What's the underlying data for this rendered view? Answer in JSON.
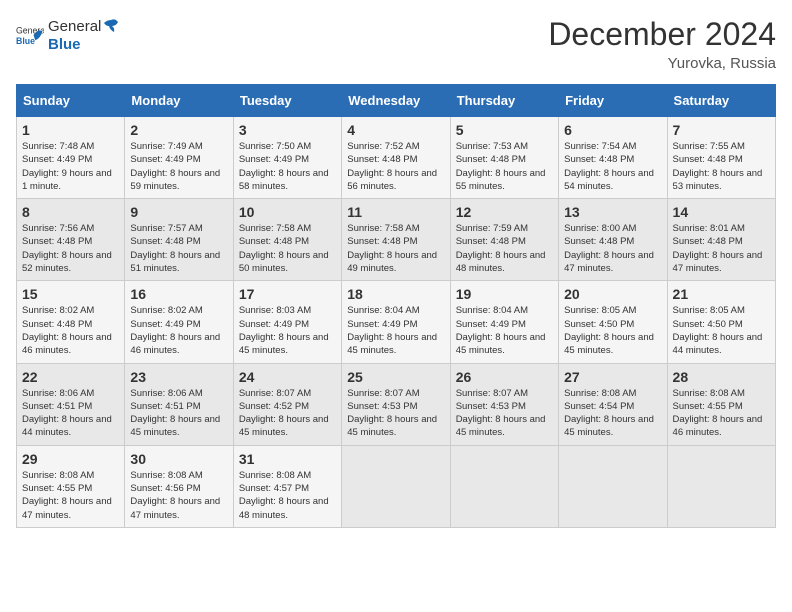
{
  "header": {
    "logo_general": "General",
    "logo_blue": "Blue",
    "title": "December 2024",
    "subtitle": "Yurovka, Russia"
  },
  "calendar": {
    "days_of_week": [
      "Sunday",
      "Monday",
      "Tuesday",
      "Wednesday",
      "Thursday",
      "Friday",
      "Saturday"
    ],
    "weeks": [
      [
        {
          "day": "1",
          "sunrise": "7:48 AM",
          "sunset": "4:49 PM",
          "daylight": "9 hours and 1 minute."
        },
        {
          "day": "2",
          "sunrise": "7:49 AM",
          "sunset": "4:49 PM",
          "daylight": "8 hours and 59 minutes."
        },
        {
          "day": "3",
          "sunrise": "7:50 AM",
          "sunset": "4:49 PM",
          "daylight": "8 hours and 58 minutes."
        },
        {
          "day": "4",
          "sunrise": "7:52 AM",
          "sunset": "4:48 PM",
          "daylight": "8 hours and 56 minutes."
        },
        {
          "day": "5",
          "sunrise": "7:53 AM",
          "sunset": "4:48 PM",
          "daylight": "8 hours and 55 minutes."
        },
        {
          "day": "6",
          "sunrise": "7:54 AM",
          "sunset": "4:48 PM",
          "daylight": "8 hours and 54 minutes."
        },
        {
          "day": "7",
          "sunrise": "7:55 AM",
          "sunset": "4:48 PM",
          "daylight": "8 hours and 53 minutes."
        }
      ],
      [
        {
          "day": "8",
          "sunrise": "7:56 AM",
          "sunset": "4:48 PM",
          "daylight": "8 hours and 52 minutes."
        },
        {
          "day": "9",
          "sunrise": "7:57 AM",
          "sunset": "4:48 PM",
          "daylight": "8 hours and 51 minutes."
        },
        {
          "day": "10",
          "sunrise": "7:58 AM",
          "sunset": "4:48 PM",
          "daylight": "8 hours and 50 minutes."
        },
        {
          "day": "11",
          "sunrise": "7:58 AM",
          "sunset": "4:48 PM",
          "daylight": "8 hours and 49 minutes."
        },
        {
          "day": "12",
          "sunrise": "7:59 AM",
          "sunset": "4:48 PM",
          "daylight": "8 hours and 48 minutes."
        },
        {
          "day": "13",
          "sunrise": "8:00 AM",
          "sunset": "4:48 PM",
          "daylight": "8 hours and 47 minutes."
        },
        {
          "day": "14",
          "sunrise": "8:01 AM",
          "sunset": "4:48 PM",
          "daylight": "8 hours and 47 minutes."
        }
      ],
      [
        {
          "day": "15",
          "sunrise": "8:02 AM",
          "sunset": "4:48 PM",
          "daylight": "8 hours and 46 minutes."
        },
        {
          "day": "16",
          "sunrise": "8:02 AM",
          "sunset": "4:49 PM",
          "daylight": "8 hours and 46 minutes."
        },
        {
          "day": "17",
          "sunrise": "8:03 AM",
          "sunset": "4:49 PM",
          "daylight": "8 hours and 45 minutes."
        },
        {
          "day": "18",
          "sunrise": "8:04 AM",
          "sunset": "4:49 PM",
          "daylight": "8 hours and 45 minutes."
        },
        {
          "day": "19",
          "sunrise": "8:04 AM",
          "sunset": "4:49 PM",
          "daylight": "8 hours and 45 minutes."
        },
        {
          "day": "20",
          "sunrise": "8:05 AM",
          "sunset": "4:50 PM",
          "daylight": "8 hours and 45 minutes."
        },
        {
          "day": "21",
          "sunrise": "8:05 AM",
          "sunset": "4:50 PM",
          "daylight": "8 hours and 44 minutes."
        }
      ],
      [
        {
          "day": "22",
          "sunrise": "8:06 AM",
          "sunset": "4:51 PM",
          "daylight": "8 hours and 44 minutes."
        },
        {
          "day": "23",
          "sunrise": "8:06 AM",
          "sunset": "4:51 PM",
          "daylight": "8 hours and 45 minutes."
        },
        {
          "day": "24",
          "sunrise": "8:07 AM",
          "sunset": "4:52 PM",
          "daylight": "8 hours and 45 minutes."
        },
        {
          "day": "25",
          "sunrise": "8:07 AM",
          "sunset": "4:53 PM",
          "daylight": "8 hours and 45 minutes."
        },
        {
          "day": "26",
          "sunrise": "8:07 AM",
          "sunset": "4:53 PM",
          "daylight": "8 hours and 45 minutes."
        },
        {
          "day": "27",
          "sunrise": "8:08 AM",
          "sunset": "4:54 PM",
          "daylight": "8 hours and 45 minutes."
        },
        {
          "day": "28",
          "sunrise": "8:08 AM",
          "sunset": "4:55 PM",
          "daylight": "8 hours and 46 minutes."
        }
      ],
      [
        {
          "day": "29",
          "sunrise": "8:08 AM",
          "sunset": "4:55 PM",
          "daylight": "8 hours and 47 minutes."
        },
        {
          "day": "30",
          "sunrise": "8:08 AM",
          "sunset": "4:56 PM",
          "daylight": "8 hours and 47 minutes."
        },
        {
          "day": "31",
          "sunrise": "8:08 AM",
          "sunset": "4:57 PM",
          "daylight": "8 hours and 48 minutes."
        },
        null,
        null,
        null,
        null
      ]
    ]
  }
}
